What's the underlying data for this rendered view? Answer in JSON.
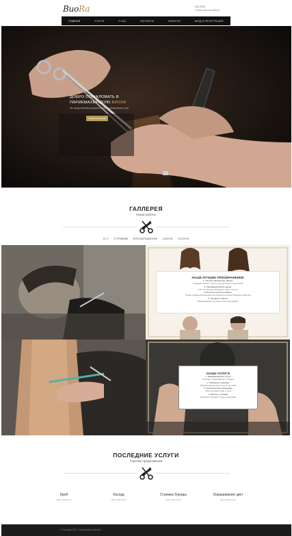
{
  "header": {
    "logo_main": "Buo",
    "logo_accent": "Ra",
    "phone": "555-5555",
    "contact_line": "Салон красоты Виола"
  },
  "nav": {
    "items": [
      "Главная",
      "Услуги",
      "О нас",
      "Контакты",
      "Новости",
      "Вход и регистрация"
    ]
  },
  "hero": {
    "title_line1": "Добро пожаловать в",
    "title_line2_main": "парикмахерскую",
    "title_line2_accent": "Виола",
    "subtitle": "Мы предоставляем широкий спектр парикмахерских услуг",
    "button_label": "Узнать больше"
  },
  "gallery": {
    "title": "ГАЛЛЕРЕЯ",
    "subtitle": "Наши работы",
    "filters": [
      "Все",
      "Стрижки",
      "Преображение",
      "Салон",
      "Услуги"
    ],
    "card1": {
      "title": "НАШЕ ЛУЧШЕЕ ПРЕОБРАЖЕНИЕ",
      "lines": [
        "1. Полное обновление образа",
        "Создание нового стиля с учётом ваших пожеланий",
        "2. Индивидуальный подход",
        "Учёт особенностей вашего лица и волос",
        "3. Высокое качество работы",
        "Только профессиональные инструменты и качественные средства",
        "4. Укладка и забота",
        "Рекомендации по уходу после процедуры"
      ]
    },
    "card2": {
      "title": "НАШИ УСЛУГИ",
      "lines": [
        "1. Парикмахерские услуги",
        "Стрижки, окрашивание, укладка",
        "2. Маникюр и педикюр",
        "Профессиональный уход за ногтями",
        "3. Косметические процедуры",
        "Уход за кожей лица и тела",
        "4. Бритьё и укладка",
        "Мужские стрижки и уход за бородой"
      ]
    }
  },
  "services": {
    "title": "ПОСЛЕДНИЕ УСЛУГИ",
    "subtitle": "Горячие предложения",
    "items": [
      {
        "name": "Крой",
        "price": "Цена: 300.0 руб"
      },
      {
        "name": "Каскад",
        "price": "Цена: 400.0 руб"
      },
      {
        "name": "Стрижка бороды",
        "price": "Цена: 250.0 руб"
      },
      {
        "name": "Окрашивание цвет",
        "price": "Цена: 600.0 руб"
      }
    ]
  },
  "footer": {
    "copyright": "© Copyright 2016. Салон красоты Виола"
  },
  "colors": {
    "accent": "#b08a42",
    "dark": "#111111",
    "footer": "#1c1c1c"
  },
  "icons": {
    "divider": "scissors-comb-icon"
  }
}
